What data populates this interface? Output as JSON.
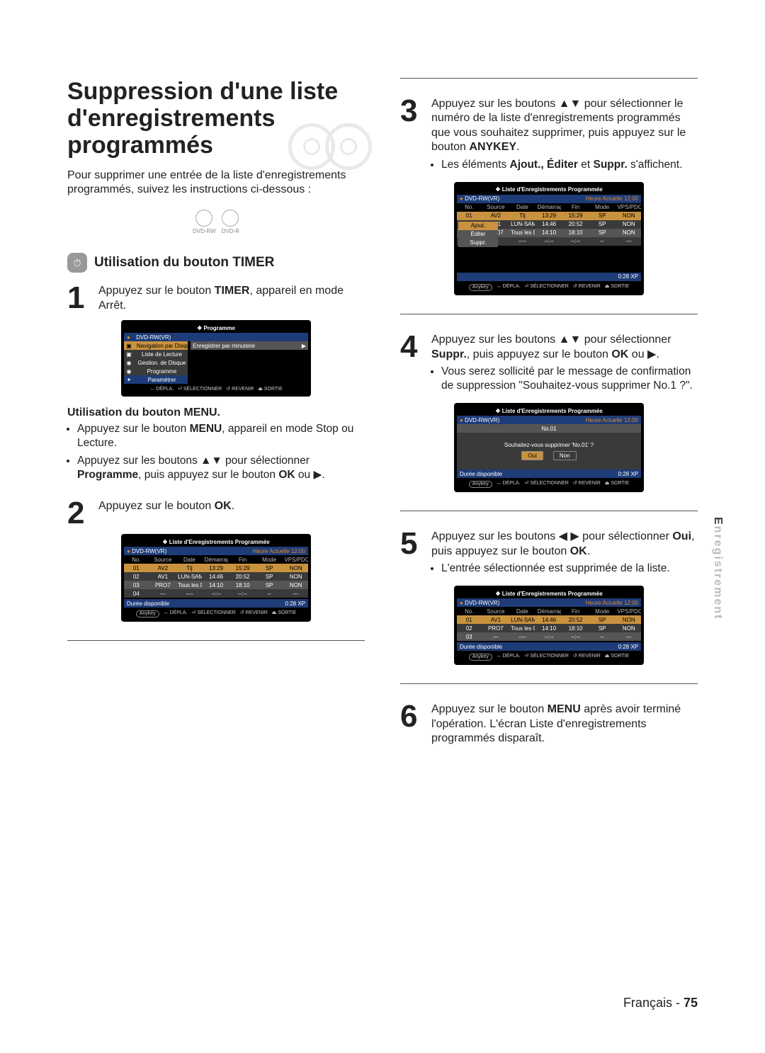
{
  "title_line1": "Suppression d'une liste",
  "title_line2": "d'enregistrements",
  "title_line3": "programmés",
  "intro": "Pour supprimer une entrée de la liste d'enregistrements programmés, suivez les instructions ci-dessous :",
  "disc_badges": [
    "DVD-RW",
    "DVD-R"
  ],
  "timer_heading": "Utilisation du bouton TIMER",
  "step1": {
    "num": "1",
    "pre": "Appuyez sur le bouton ",
    "bold": "TIMER",
    "post": ", appareil en mode Arrêt."
  },
  "menu_heading": "Utilisation du bouton MENU.",
  "menu_b1_pre": "Appuyez sur le bouton ",
  "menu_b1_bold": "MENU",
  "menu_b1_post": ", appareil en mode Stop ou Lecture.",
  "menu_b2_pre": "Appuyez sur les boutons ▲▼ pour sélectionner ",
  "menu_b2_bold": "Programme",
  "menu_b2_post": ", puis appuyez sur le bouton ",
  "menu_b2_bold2": "OK",
  "menu_b2_tail": " ou ▶.",
  "step2": {
    "num": "2",
    "pre": "Appuyez sur le bouton ",
    "bold": "OK",
    "post": "."
  },
  "step3": {
    "num": "3",
    "l1": "Appuyez sur les boutons ▲▼ pour sélectionner le numéro de la liste d'enregistrements programmés que vous souhaitez supprimer, puis appuyez sur le bouton ",
    "bold": "ANYKEY",
    "tail": ".",
    "b1_pre": "Les éléments ",
    "b1_bold": "Ajout., Éditer",
    "b1_mid": " et ",
    "b1_bold2": "Suppr.",
    "b1_post": " s'affichent."
  },
  "step4": {
    "num": "4",
    "l1": "Appuyez sur les boutons ▲▼ pour sélectionner ",
    "bold": "Suppr.",
    "mid": ", puis appuyez sur le bouton ",
    "bold2": "OK",
    "tail": " ou ▶.",
    "b1": "Vous serez sollicité par le message de confirmation de suppression \"Souhaitez-vous supprimer No.1 ?\"."
  },
  "step5": {
    "num": "5",
    "l1": "Appuyez sur les boutons ◀ ▶ pour sélectionner ",
    "bold": "Oui",
    "mid": ", puis appuyez sur le bouton ",
    "bold2": "OK",
    "tail": ".",
    "b1": "L'entrée sélectionnée est supprimée de la liste."
  },
  "step6": {
    "num": "6",
    "l1_pre": "Appuyez sur le bouton ",
    "l1_bold": "MENU",
    "l1_post": " après avoir terminé l'opération. L'écran Liste d'enregistrements programmés disparaît."
  },
  "side_tab": {
    "strong": "E",
    "rest": "nregistrement"
  },
  "footer": {
    "lang": "Français",
    "sep": " - ",
    "page": "75"
  },
  "tv_menu": {
    "title": "❖  Programme",
    "disc": "DVD-RW(VR)",
    "items": [
      "Navigation par Disque",
      "Liste de Lecture",
      "Gestion. de Disque",
      "Programme",
      "Paramétrer"
    ],
    "right": "Enregistrer par minuterie",
    "right_arrow": "▶"
  },
  "tv_list": {
    "title": "❖   Liste d'Enregistrements Programmée",
    "disc": "DVD-RW(VR)",
    "clock_label": "Heure Actuelle",
    "clock": "12:00",
    "headers": [
      "No.",
      "Source",
      "Date",
      "Démarrage",
      "Fin",
      "Mode",
      "VPS/PDC"
    ],
    "rows": [
      [
        "01",
        "AV2",
        "Tlj",
        "13:29",
        "15:29",
        "SP",
        "NON"
      ],
      [
        "02",
        "AV1",
        "LUN-SAM",
        "14:46",
        "20:52",
        "SP",
        "NON"
      ],
      [
        "03",
        "PRO7",
        "Tous les DIM",
        "14:10",
        "18:10",
        "SP",
        "NON"
      ],
      [
        "04",
        "---",
        "----",
        "--:--",
        "--:--",
        "--",
        "---"
      ]
    ],
    "avail_label": "Durée disponible",
    "avail": "0:28  XP",
    "ctx": [
      "Ajout.",
      "Éditer",
      "Suppr."
    ]
  },
  "tv_confirm": {
    "title": "❖   Liste d'Enregistrements Programmée",
    "disc": "DVD-RW(VR)",
    "clock_label": "Heure Actuelle",
    "clock": "12:00",
    "no": "No.01",
    "msg": "Souhaitez-vous supprimer 'No.01' ?",
    "yes": "Oui",
    "no_btn": "Non",
    "avail_label": "Durée disponible",
    "avail": "0:28  XP"
  },
  "tv_after": {
    "rows": [
      [
        "01",
        "AV1",
        "LUN-SAM",
        "14:46",
        "20:52",
        "SP",
        "NON"
      ],
      [
        "02",
        "PRO7",
        "Tous les DIM",
        "14:10",
        "18:10",
        "SP",
        "NON"
      ],
      [
        "03",
        "---",
        "----",
        "--:--",
        "--:--",
        "--",
        "---"
      ]
    ]
  },
  "tv_footer": [
    "Anykey",
    "↔ DÉPLA.",
    "⏎ SÉLECTIONNER",
    "↺ REVENIR",
    "⏏ SORTIE"
  ]
}
